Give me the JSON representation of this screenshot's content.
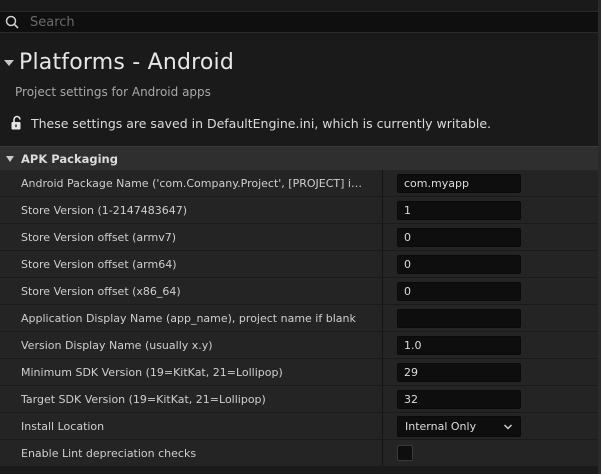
{
  "search": {
    "placeholder": "Search"
  },
  "header": {
    "title": "Platforms - Android",
    "subtitle": "Project settings for Android apps",
    "writable_message": "These settings are saved in DefaultEngine.ini, which is currently writable."
  },
  "section": {
    "title": "APK Packaging"
  },
  "rows": [
    {
      "label": "Android Package Name ('com.Company.Project', [PROJECT] is replaced with project name)",
      "value": "com.myapp"
    },
    {
      "label": "Store Version (1-2147483647)",
      "value": "1"
    },
    {
      "label": "Store Version offset (armv7)",
      "value": "0"
    },
    {
      "label": "Store Version offset (arm64)",
      "value": "0"
    },
    {
      "label": "Store Version offset (x86_64)",
      "value": "0"
    },
    {
      "label": "Application Display Name (app_name), project name if blank",
      "value": ""
    },
    {
      "label": "Version Display Name (usually x.y)",
      "value": "1.0"
    },
    {
      "label": "Minimum SDK Version (19=KitKat, 21=Lollipop)",
      "value": "29"
    },
    {
      "label": "Target SDK Version (19=KitKat, 21=Lollipop)",
      "value": "32"
    },
    {
      "label": "Install Location",
      "value": "Internal Only"
    },
    {
      "label": "Enable Lint depreciation checks",
      "checked": false
    }
  ]
}
